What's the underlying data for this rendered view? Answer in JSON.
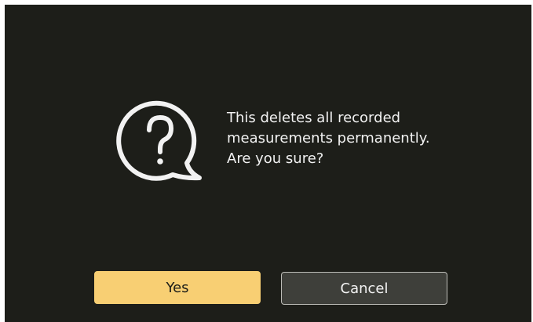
{
  "dialog": {
    "icon": "question-speech-bubble-icon",
    "message_lines": [
      "This deletes all recorded",
      "measurements permanently.",
      "Are you sure?"
    ]
  },
  "buttons": {
    "yes_label": "Yes",
    "cancel_label": "Cancel"
  },
  "colors": {
    "background": "#1d1e19",
    "text": "#f2f2f2",
    "primary_button": "#f8cf73",
    "secondary_button": "#3e3f3a",
    "secondary_border": "#bdbdb8"
  }
}
